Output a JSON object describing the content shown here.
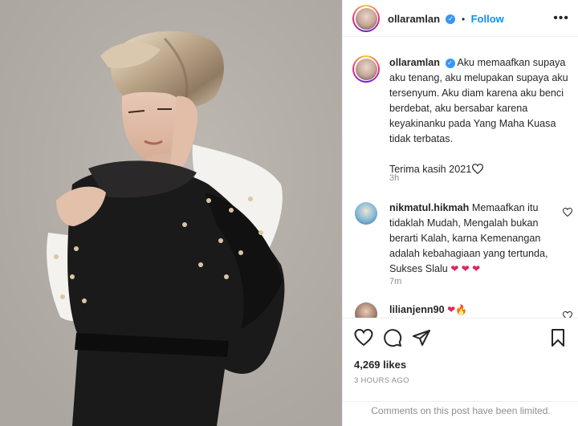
{
  "post": {
    "username": "ollaramlan",
    "follow_label": "Follow",
    "separator": "•",
    "more_icon": "more-horizontal-icon",
    "verified_icon": "verified-badge-icon"
  },
  "caption": {
    "username": "ollaramlan",
    "lines": [
      "Aku memaafkan supaya",
      "aku tenang, aku melupakan supaya aku",
      "tersenyum. Aku diam karena aku benci",
      "berdebat, aku bersabar karena",
      "keyakinanku pada Yang Maha Kuasa",
      "tidak terbatas."
    ],
    "closing": "Terima kasih 2021",
    "closing_icon": "outline-heart-icon",
    "time": "3h"
  },
  "comments": [
    {
      "username": "nikmatul.hikmah",
      "lines": [
        "Memaafkan itu",
        "tidaklah Mudah, Mengalah bukan",
        "berarti Kalah, karna Kemenangan",
        "adalah kebahagiaan yang tertunda,",
        "Sukses Slalu"
      ],
      "emoji": "❤ ❤ ❤",
      "time": "7m"
    },
    {
      "username": "lilianjenn90",
      "emoji": "❤🔥"
    }
  ],
  "actions": {
    "like_icon": "heart-icon",
    "comment_icon": "comment-icon",
    "share_icon": "share-icon",
    "save_icon": "bookmark-icon"
  },
  "likes": "4,269 likes",
  "timestamp": "3 HOURS AGO",
  "comments_limited": "Comments on this post have been limited.",
  "colors": {
    "accent_blue": "#0095f6",
    "verified_blue": "#3897f0",
    "heart_red": "#e0245e",
    "muted_gray": "#8e8e8e",
    "divider": "#efefef"
  }
}
